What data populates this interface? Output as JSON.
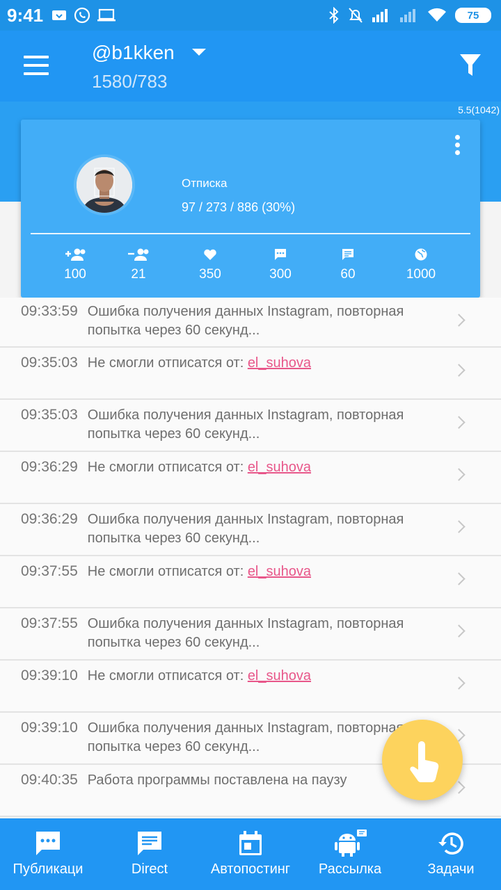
{
  "status_bar": {
    "time": "9:41",
    "battery": "75",
    "icons_left": [
      "cloud-download-icon",
      "whatsapp-icon",
      "laptop-icon"
    ],
    "icons_right": [
      "bluetooth-icon",
      "notifications-off-icon",
      "signal-icon",
      "signal-weak-icon",
      "wifi-icon",
      "battery-icon"
    ]
  },
  "header": {
    "account": "@b1kken",
    "stats": "1580/783",
    "version": "5.5(1042)"
  },
  "task_card": {
    "name": "Отписка",
    "progress": "97 / 273 / 886 (30%)",
    "stats": [
      {
        "icon": "person-add-icon",
        "value": "100"
      },
      {
        "icon": "person-remove-icon",
        "value": "21"
      },
      {
        "icon": "heart-icon",
        "value": "350"
      },
      {
        "icon": "comment-icon",
        "value": "300"
      },
      {
        "icon": "message-icon",
        "value": "60"
      },
      {
        "icon": "globe-icon",
        "value": "1000"
      }
    ]
  },
  "log": [
    {
      "time": "09:33:59",
      "text": "Ошибка получения данных Instagram, повторная попытка через 60 секунд...",
      "user": ""
    },
    {
      "time": "09:35:03",
      "text": "Не смогли отписатся от: ",
      "user": "el_suhova"
    },
    {
      "time": "09:35:03",
      "text": "Ошибка получения данных Instagram, повторная попытка через 60 секунд...",
      "user": ""
    },
    {
      "time": "09:36:29",
      "text": "Не смогли отписатся от: ",
      "user": "el_suhova"
    },
    {
      "time": "09:36:29",
      "text": "Ошибка получения данных Instagram, повторная попытка через 60 секунд...",
      "user": ""
    },
    {
      "time": "09:37:55",
      "text": "Не смогли отписатся от: ",
      "user": "el_suhova"
    },
    {
      "time": "09:37:55",
      "text": "Ошибка получения данных Instagram, повторная попытка через 60 секунд...",
      "user": ""
    },
    {
      "time": "09:39:10",
      "text": "Не смогли отписатся от: ",
      "user": "el_suhova"
    },
    {
      "time": "09:39:10",
      "text": "Ошибка получения данных Instagram, повторная попытка через 60 секунд...",
      "user": ""
    },
    {
      "time": "09:40:35",
      "text": "Работа программы поставлена на паузу",
      "user": ""
    }
  ],
  "bottom_nav": [
    {
      "label": "Публикаци",
      "icon": "chat-bubble-icon"
    },
    {
      "label": "Direct",
      "icon": "message-icon"
    },
    {
      "label": "Автопостинг",
      "icon": "calendar-icon"
    },
    {
      "label": "Рассылка",
      "icon": "android-icon"
    },
    {
      "label": "Задачи",
      "icon": "history-icon"
    }
  ],
  "colors": {
    "primary": "#2196f3",
    "card": "#42adf7",
    "link": "#e8578a",
    "fab": "#fdd35d"
  }
}
